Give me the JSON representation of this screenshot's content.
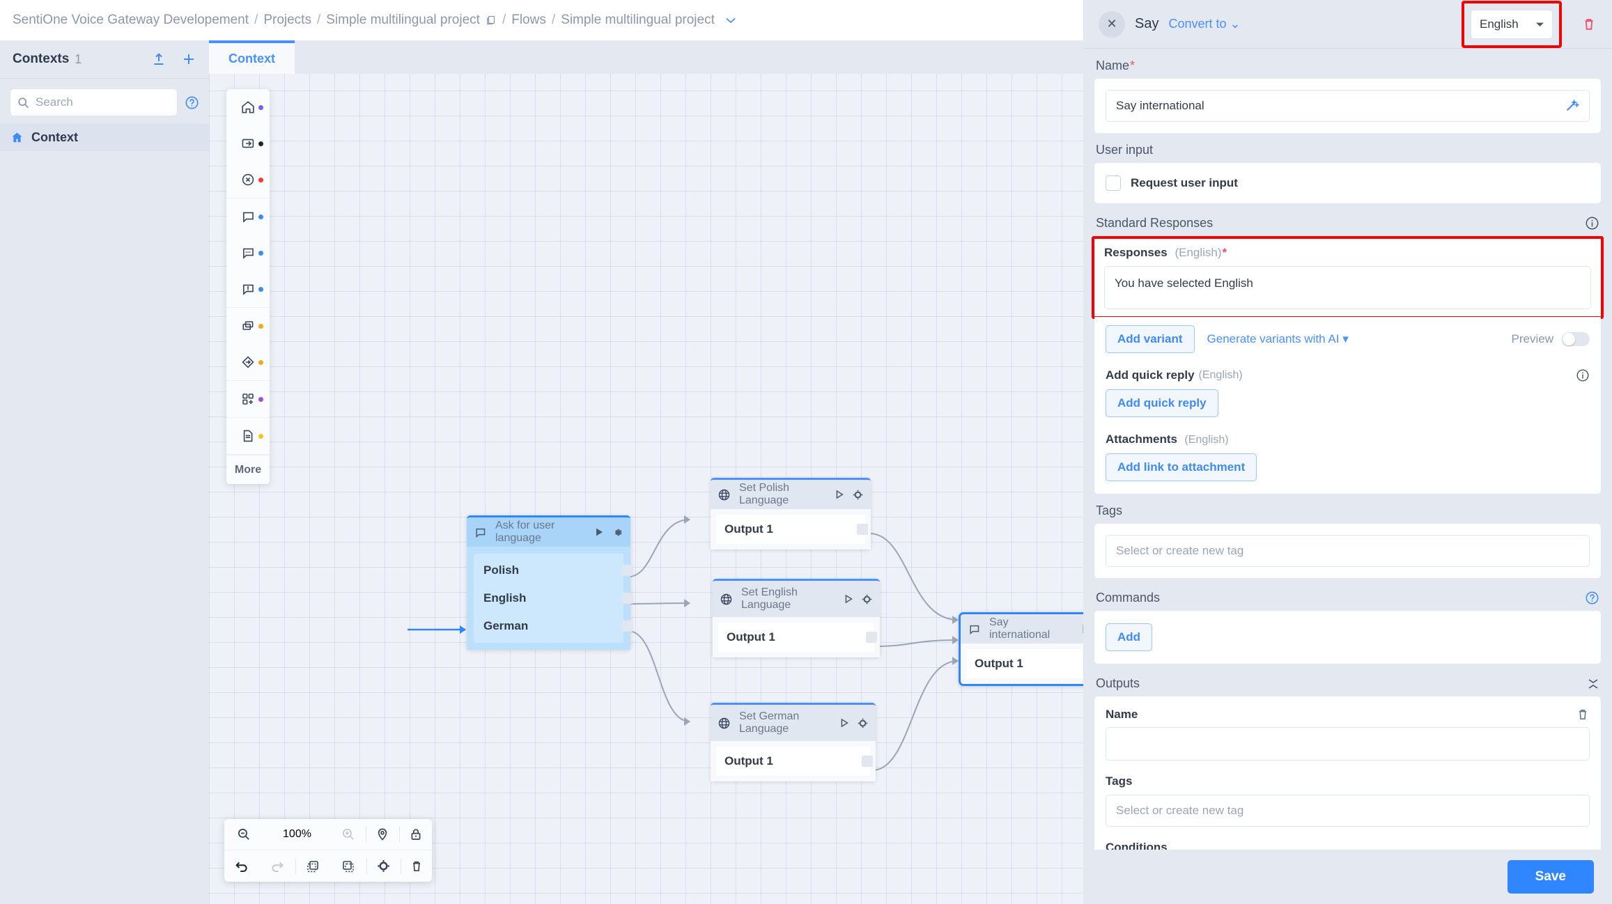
{
  "breadcrumb": {
    "items": [
      "SentiOne Voice Gateway Developement",
      "Projects",
      "Simple multilingual project",
      "Flows",
      "Simple multilingual project"
    ],
    "separator": "/"
  },
  "left_panel": {
    "title": "Contexts",
    "count": "1",
    "search_placeholder": "Search",
    "items": [
      {
        "label": "Context"
      }
    ]
  },
  "canvas": {
    "tab_label": "Context",
    "palette": {
      "more_label": "More",
      "items": [
        {
          "icon": "home-icon",
          "dot": "#7a5cf0"
        },
        {
          "icon": "enter-icon",
          "dot": "#1d2433"
        },
        {
          "icon": "end-circle-icon",
          "dot": "#f8392f"
        },
        {
          "icon": "message-icon",
          "dot": "#3e8bf5"
        },
        {
          "icon": "message-dots-icon",
          "dot": "#3e8bf5"
        },
        {
          "icon": "message-alert-icon",
          "dot": "#3e8bf5"
        },
        {
          "icon": "copy-stack-icon",
          "dot": "#f5a623"
        },
        {
          "icon": "diamond-arrow-icon",
          "dot": "#f5a623"
        },
        {
          "icon": "module-plus-icon",
          "dot": "#a34ce0"
        },
        {
          "icon": "document-icon",
          "dot": "#f5c423"
        }
      ]
    },
    "nodes": [
      {
        "id": "ask",
        "title": "Ask for user language",
        "icon": "message-icon",
        "outputs": [
          "Polish",
          "English",
          "German"
        ]
      },
      {
        "id": "polish",
        "title": "Set Polish Language",
        "icon": "globe-icon",
        "outputs": [
          "Output 1"
        ]
      },
      {
        "id": "english",
        "title": "Set English Language",
        "icon": "globe-icon",
        "outputs": [
          "Output 1"
        ]
      },
      {
        "id": "german",
        "title": "Set German Language",
        "icon": "globe-icon",
        "outputs": [
          "Output 1"
        ]
      },
      {
        "id": "say",
        "title": "Say international",
        "icon": "message-icon",
        "outputs": [
          "Output 1"
        ]
      }
    ],
    "toolbar": {
      "zoom_value": "100%",
      "zoom_out": "zoom-out-icon",
      "zoom_in": "zoom-in-icon",
      "locate": "locate-pin-icon",
      "lock": "lock-icon",
      "undo": "undo-icon",
      "redo": "redo-icon",
      "fit": "fit-to-node-icon",
      "select": "marquee-select-icon",
      "settings": "gear-icon",
      "delete": "trash-icon"
    }
  },
  "inspector": {
    "title": "Say",
    "convert_label": "Convert to",
    "language": "English",
    "close_icon": "close-icon",
    "delete_icon": "trash-icon",
    "name": {
      "label": "Name",
      "required": "*",
      "value": "Say international",
      "magic_icon": "magic-wand-icon"
    },
    "user_input": {
      "label": "User input",
      "checkbox_label": "Request user input",
      "checked": false
    },
    "standard_responses": {
      "heading": "Standard Responses",
      "responses_label": "Responses",
      "responses_lang": "(English)",
      "required": "*",
      "response_text": "You have selected English",
      "add_variant_label": "Add variant",
      "generate_ai_label": "Generate variants with AI",
      "preview_label": "Preview",
      "preview_on": false,
      "quick_reply_label": "Add quick reply",
      "quick_reply_lang": "(English)",
      "quick_reply_button": "Add quick reply",
      "attachments_label": "Attachments",
      "attachments_lang": "(English)",
      "attachments_button": "Add link to attachment"
    },
    "tags": {
      "label": "Tags",
      "placeholder": "Select or create new tag",
      "value": ""
    },
    "commands": {
      "label": "Commands",
      "add_label": "Add"
    },
    "outputs": {
      "label": "Outputs",
      "name_label": "Name",
      "name_value": "",
      "tags_label": "Tags",
      "tags_placeholder": "Select or create new tag",
      "conditions_label": "Conditions"
    },
    "save_label": "Save"
  },
  "colors": {
    "accent": "#2f86ff",
    "highlight": "#f50000",
    "danger": "#f8392f",
    "panel_bg": "#e3e8f1"
  }
}
